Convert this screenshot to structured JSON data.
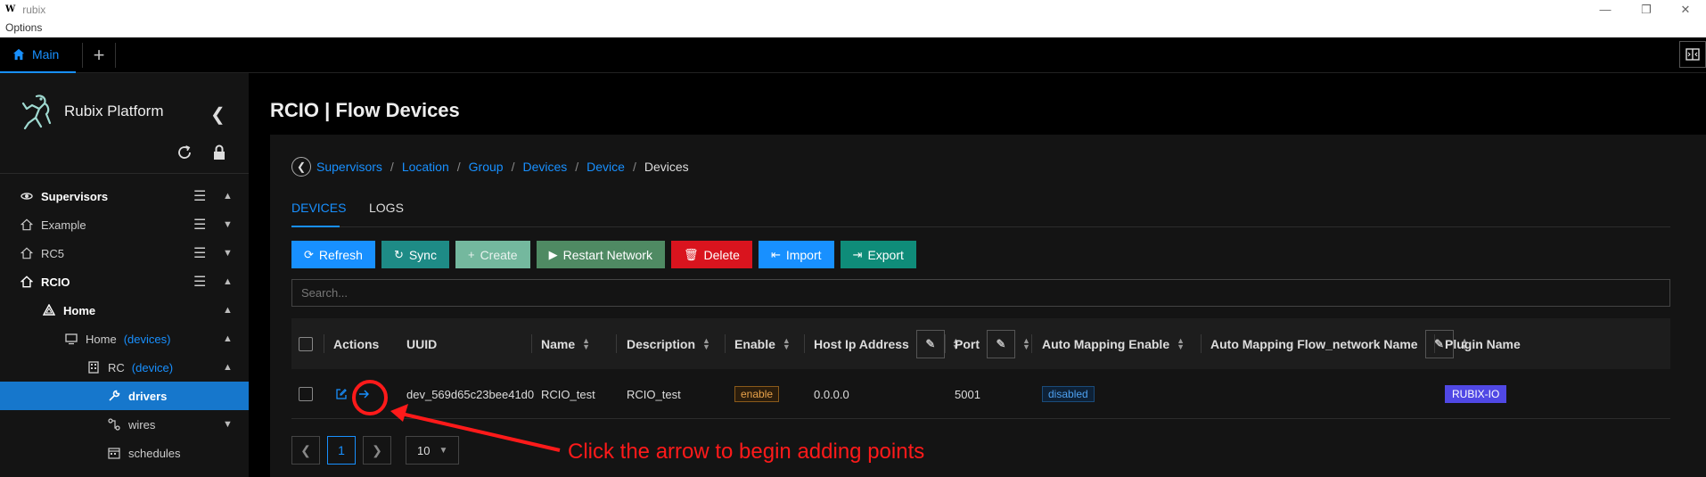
{
  "window": {
    "logo": "W",
    "title": "rubix",
    "menu": "Options"
  },
  "tabs": {
    "main_label": "Main",
    "add_label": "+"
  },
  "sidebar": {
    "brand": "Rubix Platform",
    "items": [
      {
        "label": "Supervisors",
        "icon": "satellite-icon"
      },
      {
        "label": "Example",
        "icon": "home-icon"
      },
      {
        "label": "RC5",
        "icon": "home-icon"
      },
      {
        "label": "RCIO",
        "icon": "home-icon"
      },
      {
        "label": "Home",
        "icon": "network-icon"
      },
      {
        "label": "Home",
        "tag": "(devices)",
        "icon": "monitor-icon"
      },
      {
        "label": "RC",
        "tag": "(device)",
        "icon": "building-icon"
      },
      {
        "label": "drivers",
        "icon": "wrench-icon"
      },
      {
        "label": "wires",
        "icon": "wires-icon"
      },
      {
        "label": "schedules",
        "icon": "calendar-icon"
      }
    ]
  },
  "page": {
    "title": "RCIO | Flow Devices"
  },
  "breadcrumb": {
    "items": [
      "Supervisors",
      "Location",
      "Group",
      "Devices",
      "Device"
    ],
    "current": "Devices"
  },
  "content_tabs": {
    "devices": "DEVICES",
    "logs": "LOGS"
  },
  "toolbar": {
    "refresh": "Refresh",
    "sync": "Sync",
    "create": "Create",
    "restart": "Restart Network",
    "delete": "Delete",
    "import": "Import",
    "export": "Export"
  },
  "search": {
    "placeholder": "Search..."
  },
  "table": {
    "columns": {
      "actions": "Actions",
      "uuid": "UUID",
      "name": "Name",
      "description": "Description",
      "enable": "Enable",
      "host": "Host Ip Address",
      "port": "Port",
      "auto_enable": "Auto Mapping Enable",
      "auto_name": "Auto Mapping Flow_network Name",
      "plugin": "Plugin Name"
    },
    "rows": [
      {
        "uuid": "dev_569d65c23bee41d0",
        "name": "RCIO_test",
        "description": "RCIO_test",
        "enable": "enable",
        "host": "0.0.0.0",
        "port": "5001",
        "auto_enable": "disabled",
        "plugin": "RUBIX-IO"
      }
    ]
  },
  "pagination": {
    "current_page": "1",
    "page_size": "10"
  },
  "annotation": {
    "text": "Click the arrow to begin adding points",
    "color": "#ff1a1a"
  },
  "colors": {
    "accent": "#1890ff",
    "plugin_tag": "#5048e5",
    "delete": "#d9141e"
  }
}
